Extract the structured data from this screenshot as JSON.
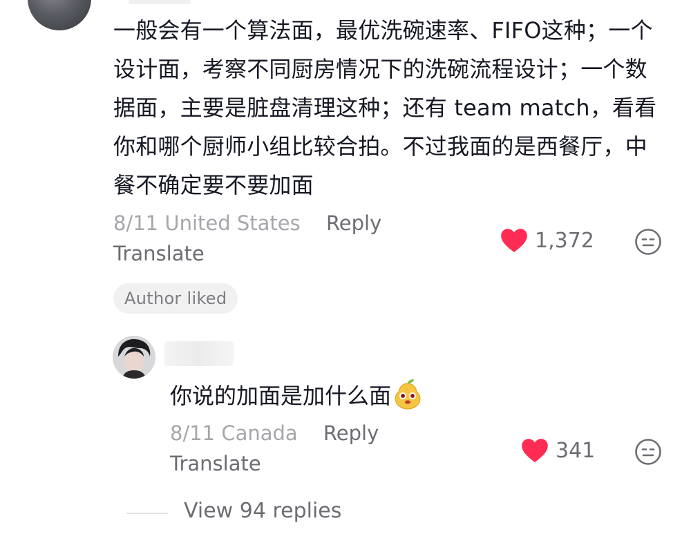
{
  "comment": {
    "text": "一般会有一个算法面，最优洗碗速率、FIFO这种；一个设计面，考察不同厨房情况下的洗碗流程设计；一个数据面，主要是脏盘清理这种；还有 team match，看看你和哪个厨师小组比较合拍。不过我面的是西餐厅，中餐不确定要不要加面",
    "date": "8/11",
    "location": "United States",
    "reply_label": "Reply",
    "translate_label": "Translate",
    "like_count": "1,372",
    "author_liked_label": "Author liked",
    "like_icon": "heart-icon",
    "dislike_icon": "meh-face-icon"
  },
  "reply": {
    "text": "你说的加面是加什么面",
    "emoji": "pear-face-emoji",
    "date": "8/11",
    "location": "Canada",
    "reply_label": "Reply",
    "translate_label": "Translate",
    "like_count": "341"
  },
  "view_replies_label": "View 94 replies",
  "colors": {
    "heart": "#fe2c55",
    "muted_text": "#a5a7ab",
    "secondary_text": "#6b6d72",
    "primary_text": "#161823"
  }
}
